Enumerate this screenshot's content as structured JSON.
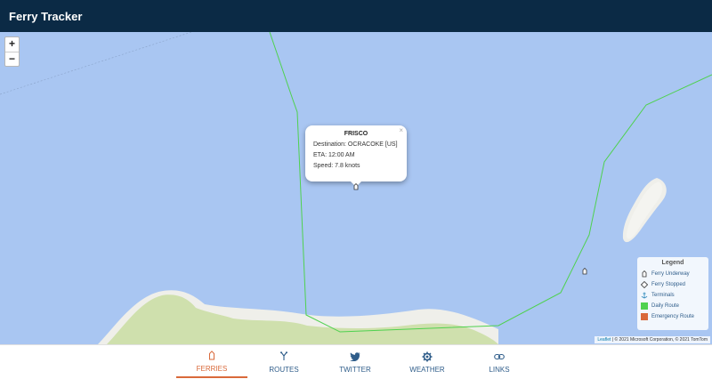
{
  "header": {
    "title": "Ferry Tracker"
  },
  "map": {
    "zoom_in": "+",
    "zoom_out": "−",
    "attribution_leaflet": "Leaflet",
    "attribution_rest": " | © 2021 Microsoft Corporation, © 2021 TomTom"
  },
  "popup": {
    "close": "×",
    "title": "FRISCO",
    "destination": "Destination: OCRACOKE [US]",
    "eta": "ETA: 12:00 AM",
    "speed": "Speed: 7.8 knots"
  },
  "legend": {
    "title": "Legend",
    "items": [
      {
        "label": "Ferry Underway",
        "icon": "ferry-icon"
      },
      {
        "label": "Ferry Stopped",
        "icon": "diamond-icon"
      },
      {
        "label": "Terminals",
        "icon": "anchor-icon"
      },
      {
        "label": "Daily Route",
        "color": "#4fd14f"
      },
      {
        "label": "Emergency Route",
        "color": "#d9693a"
      }
    ]
  },
  "tabs": [
    {
      "label": "FERRIES",
      "icon": "ferry-icon",
      "active": true
    },
    {
      "label": "ROUTES",
      "icon": "routes-icon"
    },
    {
      "label": "TWITTER",
      "icon": "twitter-icon"
    },
    {
      "label": "WEATHER",
      "icon": "gear-icon"
    },
    {
      "label": "LINKS",
      "icon": "link-icon"
    }
  ],
  "colors": {
    "header_bg": "#0b2a45",
    "water": "#a9c6f2",
    "land": "#cfe0ad",
    "sand": "#efefea",
    "route": "#4fd14f",
    "accent": "#d9693a",
    "link": "#2f5d8a"
  }
}
